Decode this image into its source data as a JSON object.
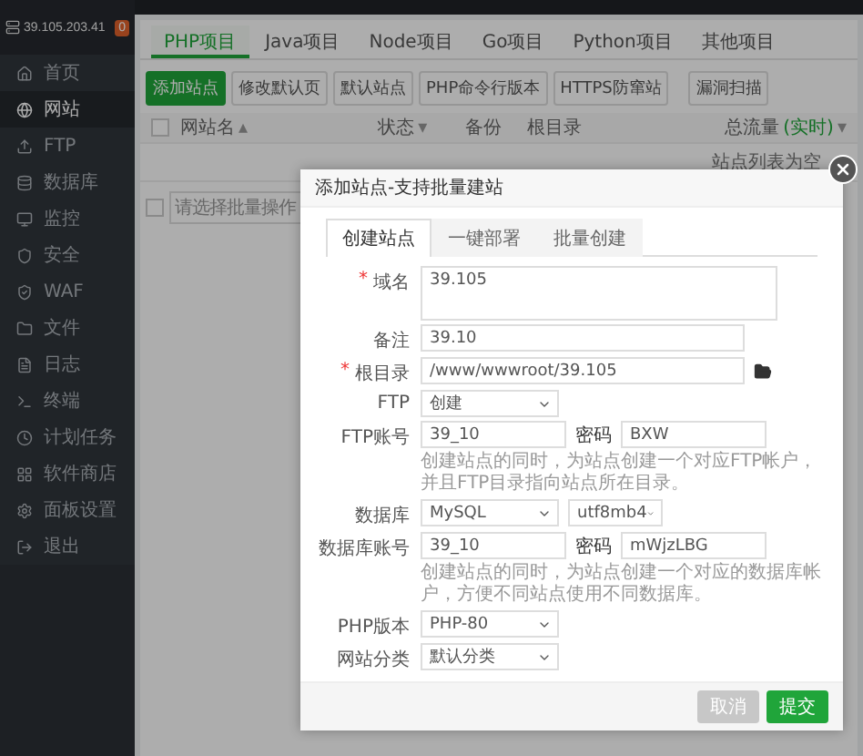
{
  "sidebar": {
    "server": "39.105.203.41",
    "badge": "0",
    "items": [
      {
        "label": "首页",
        "selected": false
      },
      {
        "label": "网站",
        "selected": true
      },
      {
        "label": "FTP",
        "selected": false
      },
      {
        "label": "数据库",
        "selected": false
      },
      {
        "label": "监控",
        "selected": false
      },
      {
        "label": "安全",
        "selected": false
      },
      {
        "label": "WAF",
        "selected": false
      },
      {
        "label": "文件",
        "selected": false
      },
      {
        "label": "日志",
        "selected": false
      },
      {
        "label": "终端",
        "selected": false
      },
      {
        "label": "计划任务",
        "selected": false
      },
      {
        "label": "软件商店",
        "selected": false
      },
      {
        "label": "面板设置",
        "selected": false
      },
      {
        "label": "退出",
        "selected": false
      }
    ]
  },
  "tabs": [
    {
      "label": "PHP项目",
      "selected": true
    },
    {
      "label": "Java项目",
      "selected": false
    },
    {
      "label": "Node项目",
      "selected": false
    },
    {
      "label": "Go项目",
      "selected": false
    },
    {
      "label": "Python项目",
      "selected": false
    },
    {
      "label": "其他项目",
      "selected": false
    }
  ],
  "toolbar": [
    {
      "label": "添加站点",
      "kind": "primary"
    },
    {
      "label": "修改默认页",
      "kind": "plain"
    },
    {
      "label": "默认站点",
      "kind": "plain"
    },
    {
      "label": "PHP命令行版本",
      "kind": "plain"
    },
    {
      "label": "HTTPS防窜站",
      "kind": "plain"
    },
    {
      "label": "漏洞扫描",
      "kind": "separated"
    }
  ],
  "table": {
    "select_all_checked": false,
    "columns": [
      {
        "label": "网站名",
        "arrow": "▴"
      },
      {
        "label": "状态",
        "arrow": "▾"
      },
      {
        "label": "备份"
      },
      {
        "label": "根目录"
      },
      {
        "label": "总流量",
        "note": "(实时)",
        "arrow": "▾"
      }
    ],
    "empty_text": "站点列表为空",
    "batch": {
      "checked": false,
      "placeholder": "请选择批量操作"
    }
  },
  "dialog": {
    "title": "添加站点-支持批量建站",
    "tabs": [
      {
        "label": "创建站点",
        "selected": true
      },
      {
        "label": "一键部署",
        "selected": false
      },
      {
        "label": "批量创建",
        "selected": false
      }
    ],
    "fields": [
      {
        "kind": "textarea",
        "marker": "*",
        "label": "域名",
        "value": "39.105"
      },
      {
        "kind": "input",
        "label": "备注",
        "value": "39.10"
      },
      {
        "kind": "path",
        "marker": "*",
        "label": "根目录",
        "value": "/www/wwwroot/39.105"
      },
      {
        "kind": "select",
        "label": "FTP",
        "options": [
          "创建"
        ]
      },
      {
        "kind": "account",
        "label": "FTP账号",
        "value": "39_10",
        "password_label": "密码",
        "password": "BXW",
        "hint": "创建站点的同时，为站点创建一个对应FTP帐户，并且FTP目录指向站点所在目录。"
      },
      {
        "kind": "select",
        "label": "数据库",
        "options": [
          "MySQL",
          "utf8mb4"
        ]
      },
      {
        "kind": "account",
        "label": "数据库账号",
        "value": "39_10",
        "password_label": "密码",
        "password": "mWjzLBG",
        "hint": "创建站点的同时，为站点创建一个对应的数据库帐户，方便不同站点使用不同数据库。"
      },
      {
        "kind": "select",
        "label": "PHP版本",
        "options": [
          "PHP-80"
        ]
      },
      {
        "kind": "select",
        "label": "网站分类",
        "options": [
          "默认分类"
        ]
      }
    ],
    "buttons": [
      {
        "label": "取消",
        "kind": "cancel"
      },
      {
        "label": "提交",
        "kind": "submit"
      }
    ]
  }
}
